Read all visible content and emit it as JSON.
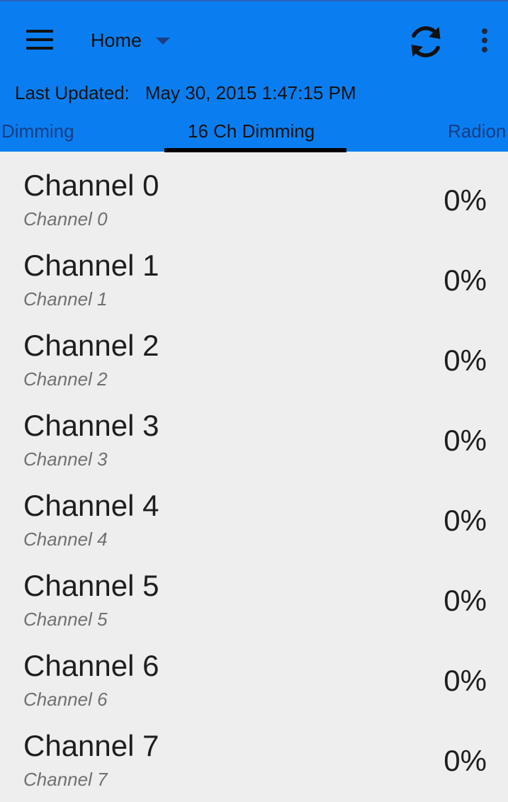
{
  "colors": {
    "action_bar": "#0a7ef0",
    "list_background": "#eeeeee",
    "tab_text_inactive": "#163c82",
    "tab_indicator": "#000000"
  },
  "header": {
    "menu_icon": "hamburger-icon",
    "spinner_value": "Home",
    "spinner_icon": "triangle-down-icon",
    "refresh_icon": "refresh-icon",
    "overflow_icon": "more-vertical-icon"
  },
  "status": {
    "last_updated_label": "Last Updated:",
    "last_updated_value": "May 30, 2015 1:47:15 PM"
  },
  "tabs": [
    {
      "label": "Dimming",
      "active": false
    },
    {
      "label": "16 Ch Dimming",
      "active": true
    },
    {
      "label": "Radion",
      "active": false
    }
  ],
  "channels": [
    {
      "name": "Channel 0",
      "subtitle": "Channel 0",
      "value": "0%"
    },
    {
      "name": "Channel 1",
      "subtitle": "Channel 1",
      "value": "0%"
    },
    {
      "name": "Channel 2",
      "subtitle": "Channel 2",
      "value": "0%"
    },
    {
      "name": "Channel 3",
      "subtitle": "Channel 3",
      "value": "0%"
    },
    {
      "name": "Channel 4",
      "subtitle": "Channel 4",
      "value": "0%"
    },
    {
      "name": "Channel 5",
      "subtitle": "Channel 5",
      "value": "0%"
    },
    {
      "name": "Channel 6",
      "subtitle": "Channel 6",
      "value": "0%"
    },
    {
      "name": "Channel 7",
      "subtitle": "Channel 7",
      "value": "0%"
    }
  ]
}
